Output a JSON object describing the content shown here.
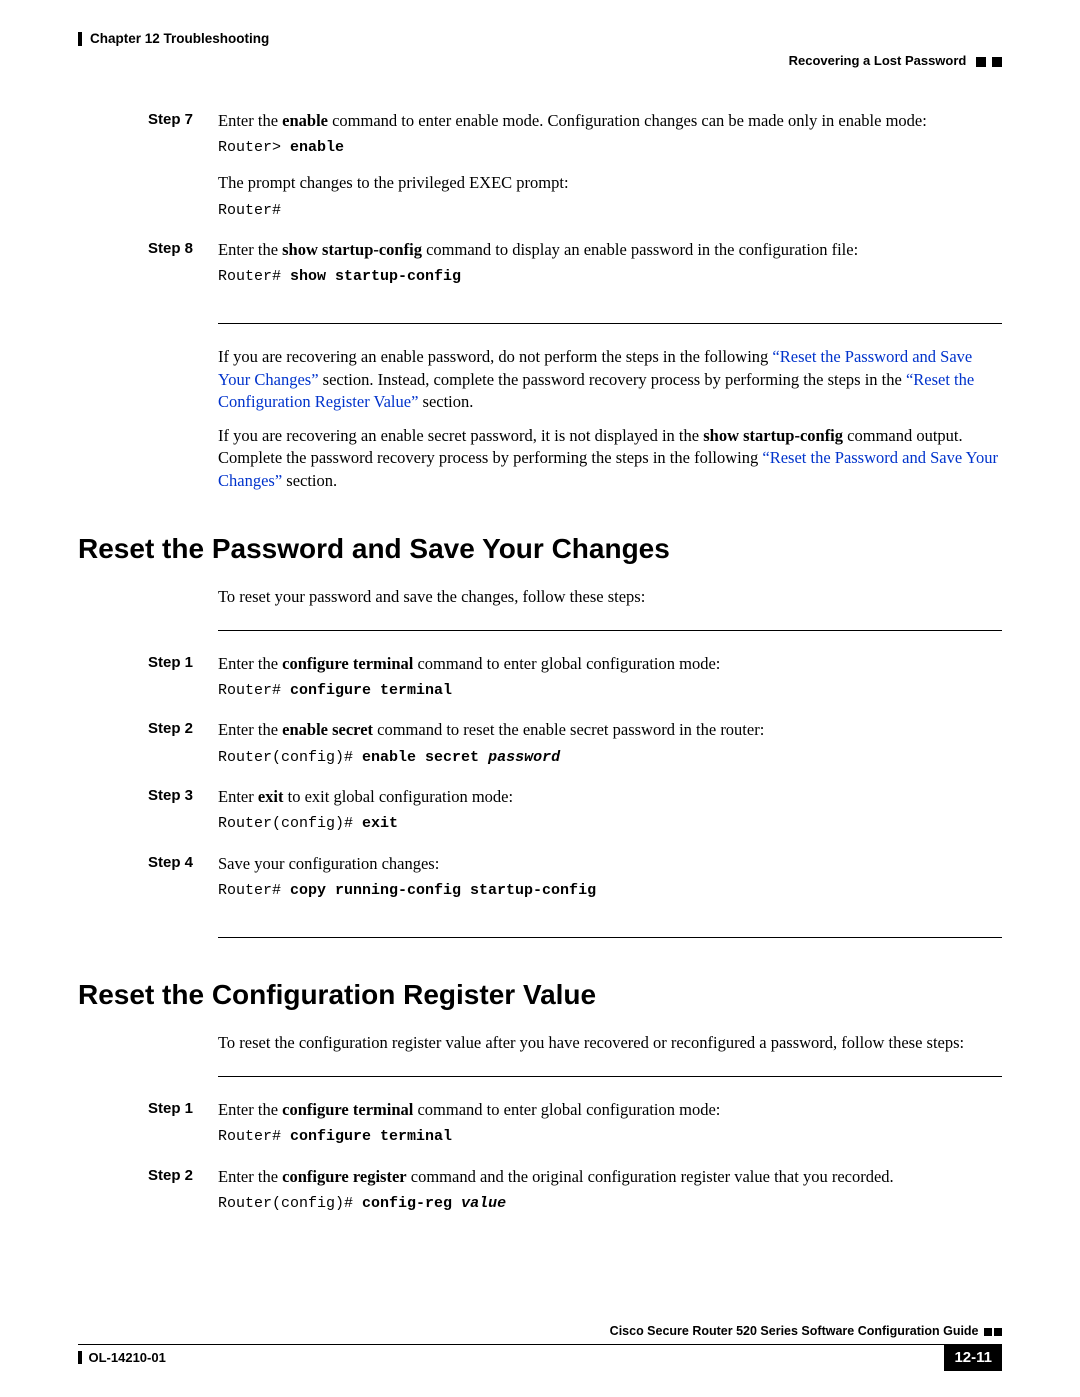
{
  "header": {
    "chapter": "Chapter 12    Troubleshooting",
    "section": "Recovering a Lost Password"
  },
  "steps_top": {
    "step7": {
      "label": "Step 7",
      "text_before": "Enter the ",
      "cmd": "enable",
      "text_after": " command to enter enable mode. Configuration changes can be made only in enable mode:",
      "code_prompt": "Router> ",
      "code_cmd": "enable",
      "note": "The prompt changes to the privileged EXEC prompt:",
      "code2": "Router#"
    },
    "step8": {
      "label": "Step 8",
      "text_before": "Enter the ",
      "cmd": "show startup-config",
      "text_after": " command to display an enable password in the configuration file:",
      "code_prompt": "Router# ",
      "code_cmd": "show startup-config"
    }
  },
  "mid_paras": {
    "p1a": "If you are recovering an enable password, do not perform the steps in the following ",
    "p1_link1": "“Reset the Password and Save Your Changes”",
    "p1b": " section. Instead, complete the password recovery process by performing the steps in the ",
    "p1_link2": "“Reset the Configuration Register Value”",
    "p1c": " section.",
    "p2a": "If you are recovering an enable secret password, it is not displayed in the ",
    "p2_cmd": "show startup-config",
    "p2b": " command output. Complete the password recovery process by performing the steps in the following ",
    "p2_link": "“Reset the Password and Save Your Changes”",
    "p2c": " section."
  },
  "section1": {
    "title": "Reset the Password and Save Your Changes",
    "intro": "To reset your password and save the changes, follow these steps:",
    "step1": {
      "label": "Step 1",
      "text_before": "Enter the ",
      "cmd": "configure terminal",
      "text_after": " command to enter global configuration mode:",
      "code_prompt": "Router# ",
      "code_cmd": "configure terminal"
    },
    "step2": {
      "label": "Step 2",
      "text_before": "Enter the ",
      "cmd": "enable secret",
      "text_after": " command to reset the enable secret password in the router:",
      "code_prompt": "Router(config)# ",
      "code_cmd": "enable secret ",
      "code_arg": "password"
    },
    "step3": {
      "label": "Step 3",
      "text_before": "Enter ",
      "cmd": "exit",
      "text_after": " to exit global configuration mode:",
      "code_prompt": "Router(config)# ",
      "code_cmd": "exit"
    },
    "step4": {
      "label": "Step 4",
      "text": "Save your configuration changes:",
      "code_prompt": "Router# ",
      "code_cmd": "copy running-config startup-config"
    }
  },
  "section2": {
    "title": "Reset the Configuration Register Value",
    "intro": "To reset the configuration register value after you have recovered or reconfigured a password, follow these steps:",
    "step1": {
      "label": "Step 1",
      "text_before": "Enter the ",
      "cmd": "configure terminal",
      "text_after": " command to enter global configuration mode:",
      "code_prompt": "Router# ",
      "code_cmd": "configure terminal"
    },
    "step2": {
      "label": "Step 2",
      "text_before": "Enter the ",
      "cmd": "configure register",
      "text_after": " command and the original configuration register value that you recorded.",
      "code_prompt": "Router(config)# ",
      "code_cmd": "config-reg ",
      "code_arg": "value"
    }
  },
  "footer": {
    "guide": "Cisco Secure Router 520 Series Software Configuration Guide",
    "doc": "OL-14210-01",
    "page": "12-11"
  }
}
